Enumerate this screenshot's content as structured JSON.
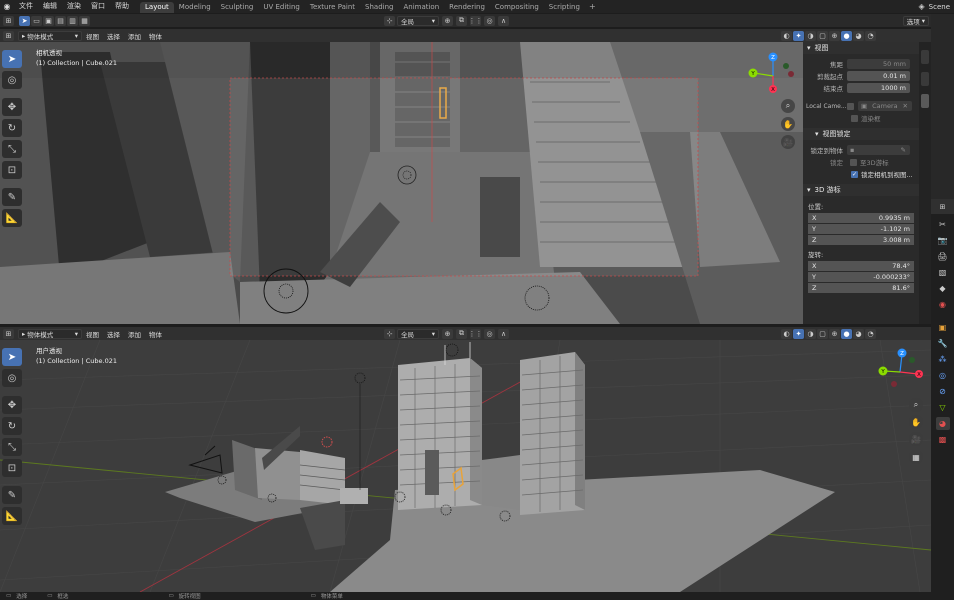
{
  "topbar": {
    "menus": [
      "文件",
      "编辑",
      "渲染",
      "窗口",
      "帮助"
    ],
    "workspaces": [
      "Layout",
      "Modeling",
      "Sculpting",
      "UV Editing",
      "Texture Paint",
      "Shading",
      "Animation",
      "Rendering",
      "Compositing",
      "Scripting"
    ],
    "active_workspace": "Layout",
    "options_label": "选项",
    "scene": "Scene"
  },
  "top_view": {
    "mode": "物体模式",
    "menus": [
      "视图",
      "选择",
      "添加",
      "物体"
    ],
    "orientation": "全局",
    "view_name": "相机透视",
    "object_info": "(1) Collection | Cube.021"
  },
  "bottom_view": {
    "mode": "物体模式",
    "menus": [
      "视图",
      "选择",
      "添加",
      "物体"
    ],
    "orientation": "全局",
    "view_name": "用户透视",
    "object_info": "(1) Collection | Cube.021"
  },
  "npanel": {
    "view_section": "视图",
    "focal_label": "焦距",
    "focal_value": "50 mm",
    "clip_start_label": "剪裁起点",
    "clip_start_value": "0.01 m",
    "clip_end_label": "结束点",
    "clip_end_value": "1000 m",
    "local_camera_label": "Local Came...",
    "camera_field": "Camera",
    "render_region_label": "渲染框",
    "view_lock_section": "视图锁定",
    "lock_to_object_label": "锁定到物体",
    "lock_label": "锁定",
    "lock_3d_cursor_label": "至3D游标",
    "lock_camera_label": "锁定相机到视图...",
    "cursor_section": "3D 游标",
    "location_label": "位置:",
    "location": [
      {
        "axis": "X",
        "value": "0.9935 m"
      },
      {
        "axis": "Y",
        "value": "-1.102 m"
      },
      {
        "axis": "Z",
        "value": "3.008 m"
      }
    ],
    "rotation_label": "旋转:",
    "rotation": [
      {
        "axis": "X",
        "value": "78.4°"
      },
      {
        "axis": "Y",
        "value": "-0.000233°"
      },
      {
        "axis": "Z",
        "value": "81.6°"
      }
    ]
  },
  "gizmo_top": {
    "z": "Z",
    "y": "Y",
    "x": "X"
  },
  "gizmo_bottom": {
    "z": "Z",
    "y": "Y",
    "x": "X"
  },
  "statusbar": {
    "items": [
      "选择",
      "框选",
      "旋转视图",
      "物体菜单"
    ]
  },
  "colors": {
    "accent": "#4772b3",
    "active_tab": "#3d3d3d",
    "viewport": "#3d3d3d",
    "x_axis": "#ff3352",
    "y_axis": "#8bdc00",
    "z_axis": "#2890ff"
  }
}
